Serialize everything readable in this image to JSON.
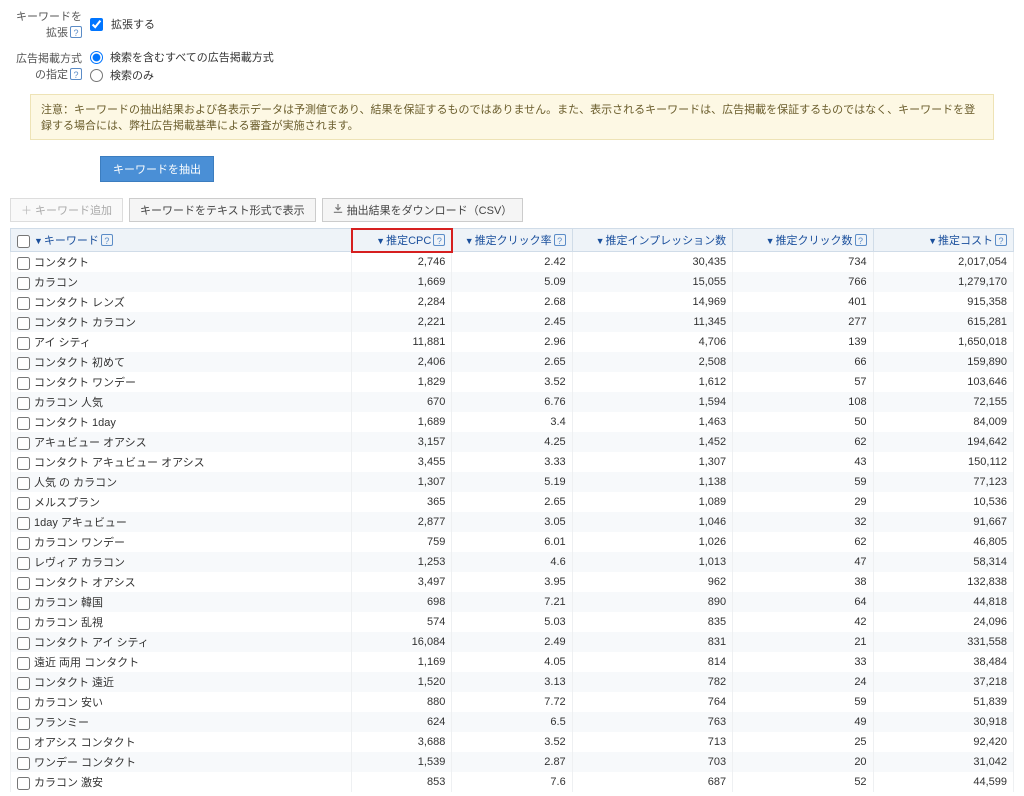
{
  "form": {
    "extend_label": "キーワードを拡張",
    "extend_checkbox": "拡張する",
    "adtype_label": "広告掲載方式の指定",
    "adtype_opt1": "検索を含むすべての広告掲載方式",
    "adtype_opt2": "検索のみ"
  },
  "notice": "注意：キーワードの抽出結果および各表示データは予測値であり、結果を保証するものではありません。また、表示されるキーワードは、広告掲載を保証するものではなく、キーワードを登録する場合には、弊社広告掲載基準による審査が実施されます。",
  "buttons": {
    "extract": "キーワードを抽出",
    "add": "キーワード追加",
    "showtext": "キーワードをテキスト形式で表示",
    "download": "抽出結果をダウンロード（CSV）"
  },
  "cols": {
    "keyword": "キーワード",
    "cpc": "推定CPC",
    "ctr": "推定クリック率",
    "imp": "推定インプレッション数",
    "clicks": "推定クリック数",
    "cost": "推定コスト"
  },
  "rows": [
    {
      "kw": "コンタクト",
      "cpc": "2,746",
      "ctr": "2.42",
      "imp": "30,435",
      "clk": "734",
      "cost": "2,017,054"
    },
    {
      "kw": "カラコン",
      "cpc": "1,669",
      "ctr": "5.09",
      "imp": "15,055",
      "clk": "766",
      "cost": "1,279,170"
    },
    {
      "kw": "コンタクト レンズ",
      "cpc": "2,284",
      "ctr": "2.68",
      "imp": "14,969",
      "clk": "401",
      "cost": "915,358"
    },
    {
      "kw": "コンタクト カラコン",
      "cpc": "2,221",
      "ctr": "2.45",
      "imp": "11,345",
      "clk": "277",
      "cost": "615,281"
    },
    {
      "kw": "アイ シティ",
      "cpc": "11,881",
      "ctr": "2.96",
      "imp": "4,706",
      "clk": "139",
      "cost": "1,650,018"
    },
    {
      "kw": "コンタクト 初めて",
      "cpc": "2,406",
      "ctr": "2.65",
      "imp": "2,508",
      "clk": "66",
      "cost": "159,890"
    },
    {
      "kw": "コンタクト ワンデー",
      "cpc": "1,829",
      "ctr": "3.52",
      "imp": "1,612",
      "clk": "57",
      "cost": "103,646"
    },
    {
      "kw": "カラコン 人気",
      "cpc": "670",
      "ctr": "6.76",
      "imp": "1,594",
      "clk": "108",
      "cost": "72,155"
    },
    {
      "kw": "コンタクト 1day",
      "cpc": "1,689",
      "ctr": "3.4",
      "imp": "1,463",
      "clk": "50",
      "cost": "84,009"
    },
    {
      "kw": "アキュビュー オアシス",
      "cpc": "3,157",
      "ctr": "4.25",
      "imp": "1,452",
      "clk": "62",
      "cost": "194,642"
    },
    {
      "kw": "コンタクト アキュビュー オアシス",
      "cpc": "3,455",
      "ctr": "3.33",
      "imp": "1,307",
      "clk": "43",
      "cost": "150,112"
    },
    {
      "kw": "人気 の カラコン",
      "cpc": "1,307",
      "ctr": "5.19",
      "imp": "1,138",
      "clk": "59",
      "cost": "77,123"
    },
    {
      "kw": "メルスプラン",
      "cpc": "365",
      "ctr": "2.65",
      "imp": "1,089",
      "clk": "29",
      "cost": "10,536"
    },
    {
      "kw": "1day アキュビュー",
      "cpc": "2,877",
      "ctr": "3.05",
      "imp": "1,046",
      "clk": "32",
      "cost": "91,667"
    },
    {
      "kw": "カラコン ワンデー",
      "cpc": "759",
      "ctr": "6.01",
      "imp": "1,026",
      "clk": "62",
      "cost": "46,805"
    },
    {
      "kw": "レヴィア カラコン",
      "cpc": "1,253",
      "ctr": "4.6",
      "imp": "1,013",
      "clk": "47",
      "cost": "58,314"
    },
    {
      "kw": "コンタクト オアシス",
      "cpc": "3,497",
      "ctr": "3.95",
      "imp": "962",
      "clk": "38",
      "cost": "132,838"
    },
    {
      "kw": "カラコン 韓国",
      "cpc": "698",
      "ctr": "7.21",
      "imp": "890",
      "clk": "64",
      "cost": "44,818"
    },
    {
      "kw": "カラコン 乱視",
      "cpc": "574",
      "ctr": "5.03",
      "imp": "835",
      "clk": "42",
      "cost": "24,096"
    },
    {
      "kw": "コンタクト アイ シティ",
      "cpc": "16,084",
      "ctr": "2.49",
      "imp": "831",
      "clk": "21",
      "cost": "331,558"
    },
    {
      "kw": "遠近 両用 コンタクト",
      "cpc": "1,169",
      "ctr": "4.05",
      "imp": "814",
      "clk": "33",
      "cost": "38,484"
    },
    {
      "kw": "コンタクト 遠近",
      "cpc": "1,520",
      "ctr": "3.13",
      "imp": "782",
      "clk": "24",
      "cost": "37,218"
    },
    {
      "kw": "カラコン 安い",
      "cpc": "880",
      "ctr": "7.72",
      "imp": "764",
      "clk": "59",
      "cost": "51,839"
    },
    {
      "kw": "フランミー",
      "cpc": "624",
      "ctr": "6.5",
      "imp": "763",
      "clk": "49",
      "cost": "30,918"
    },
    {
      "kw": "オアシス コンタクト",
      "cpc": "3,688",
      "ctr": "3.52",
      "imp": "713",
      "clk": "25",
      "cost": "92,420"
    },
    {
      "kw": "ワンデー コンタクト",
      "cpc": "1,539",
      "ctr": "2.87",
      "imp": "703",
      "clk": "20",
      "cost": "31,042"
    },
    {
      "kw": "カラコン 激安",
      "cpc": "853",
      "ctr": "7.6",
      "imp": "687",
      "clk": "52",
      "cost": "44,599"
    }
  ]
}
